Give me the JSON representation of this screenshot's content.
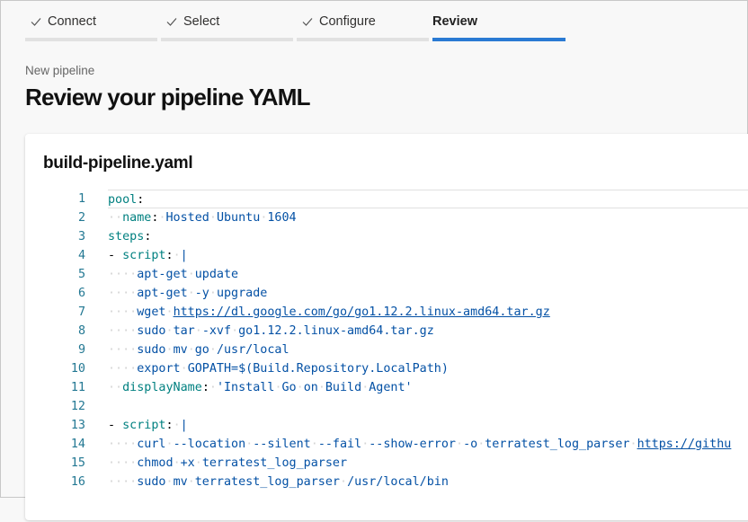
{
  "wizard": {
    "steps": [
      {
        "label": "Connect",
        "done": true
      },
      {
        "label": "Select",
        "done": true
      },
      {
        "label": "Configure",
        "done": true
      },
      {
        "label": "Review",
        "done": false,
        "active": true
      }
    ]
  },
  "header": {
    "subtitle": "New pipeline",
    "title": "Review your pipeline YAML"
  },
  "editor": {
    "file_name": "build-pipeline.yaml",
    "line_numbers": [
      "1",
      "2",
      "3",
      "4",
      "5",
      "6",
      "7",
      "8",
      "9",
      "10",
      "11",
      "12",
      "13",
      "14",
      "15",
      "16"
    ],
    "lines": [
      "pool:",
      "  name: Hosted Ubuntu 1604",
      "steps:",
      "- script: |",
      "    apt-get update",
      "    apt-get -y upgrade",
      "    wget https://dl.google.com/go/go1.12.2.linux-amd64.tar.gz",
      "    sudo tar -xvf go1.12.2.linux-amd64.tar.gz",
      "    sudo mv go /usr/local",
      "    export GOPATH=$(Build.Repository.LocalPath)",
      "  displayName: 'Install Go on Build Agent'",
      "",
      "- script: |",
      "    curl --location --silent --fail --show-error -o terratest_log_parser https://githu",
      "    chmod +x terratest_log_parser",
      "    sudo mv terratest_log_parser /usr/local/bin"
    ]
  },
  "colors": {
    "accent": "#2a7ad3",
    "line_number": "#237893",
    "yaml_key": "#008080",
    "yaml_value": "#0451a5"
  }
}
